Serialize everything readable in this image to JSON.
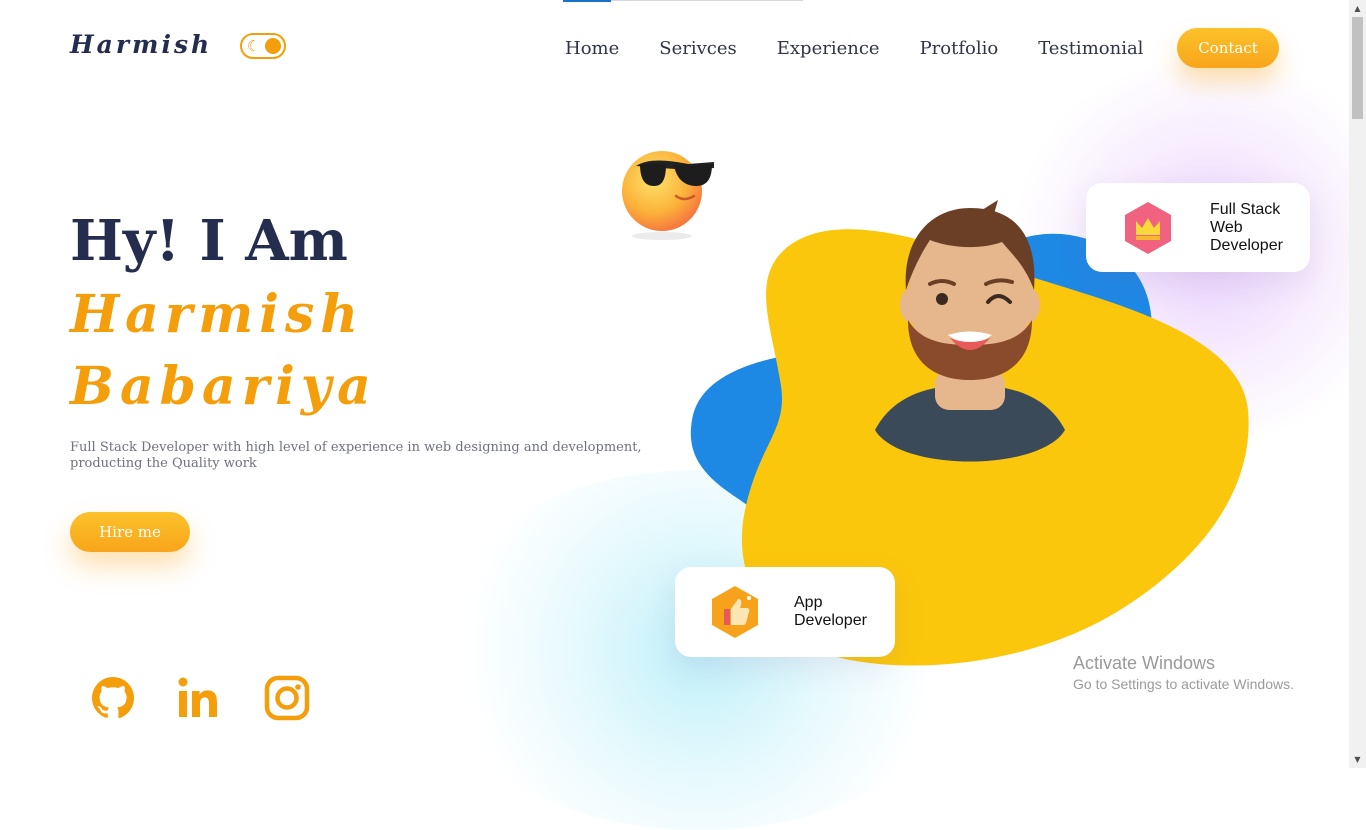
{
  "header": {
    "logo": "Harmish",
    "theme_toggle_icon": "moon-icon",
    "nav": [
      "Home",
      "Serivces",
      "Experience",
      "Protfolio",
      "Testimonial"
    ],
    "contact_label": "Contact"
  },
  "hero": {
    "greeting": "Hy! I Am",
    "first_name": "Harmish",
    "last_name": "Babariya",
    "description": "Full Stack Developer with high level of experience in web designing and development, producting the Quality work",
    "hire_label": "Hire me"
  },
  "social": [
    "github-icon",
    "linkedin-icon",
    "instagram-icon"
  ],
  "cards": {
    "fullstack": "Full Stack Web Developer",
    "app": "App Developer"
  },
  "watermark": {
    "title": "Activate Windows",
    "subtitle": "Go to Settings to activate Windows."
  },
  "colors": {
    "accent": "#f59e0b",
    "heading": "#242d4e",
    "blob_yellow": "#fbc70c",
    "blob_blue": "#1e88e5"
  }
}
